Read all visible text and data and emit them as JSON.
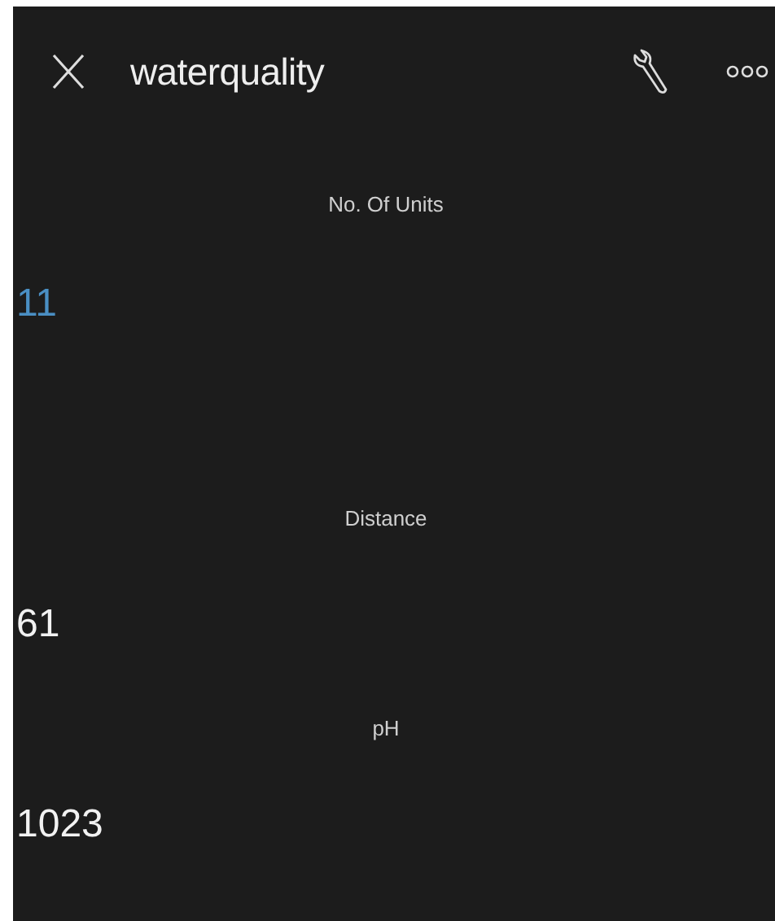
{
  "header": {
    "title": "waterquality"
  },
  "widgets": [
    {
      "label": "No. Of Units",
      "value": "11",
      "color": "#4a8fc4"
    },
    {
      "label": "Distance",
      "value": "61",
      "color": "#f2f2f2"
    },
    {
      "label": "pH",
      "value": "1023",
      "color": "#f2f2f2"
    }
  ]
}
